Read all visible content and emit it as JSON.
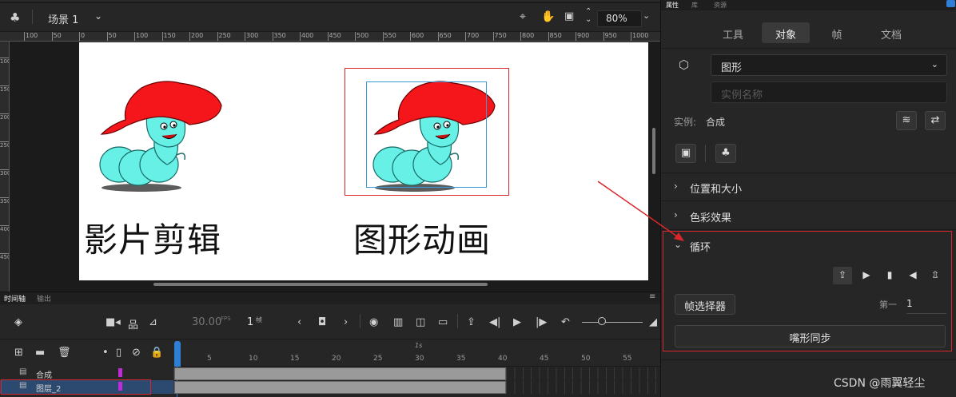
{
  "scene": {
    "label": "场景 1",
    "zoom": "80%"
  },
  "ruler": {
    "top_ticks": [
      "100",
      "50",
      "0",
      "50",
      "100",
      "150",
      "200",
      "250",
      "300",
      "350",
      "400",
      "450",
      "500",
      "550",
      "600",
      "650",
      "700",
      "750",
      "800",
      "850",
      "900",
      "950",
      "1000"
    ],
    "left_ticks": [
      "100",
      "150",
      "200",
      "250",
      "300",
      "350",
      "400",
      "450"
    ]
  },
  "canvas": {
    "caption_left": "影片剪辑",
    "caption_right": "图形动画"
  },
  "timeline": {
    "tab_timeline": "时间轴",
    "tab_output": "输出",
    "fps": "30.00",
    "fps_unit": "FPS",
    "frame": "1",
    "frame_unit": "帧",
    "seconds_marker": "1s",
    "frame_numbers": [
      "5",
      "10",
      "15",
      "20",
      "25",
      "30",
      "35",
      "40",
      "45",
      "50",
      "55"
    ],
    "layers": [
      {
        "name": "合成"
      },
      {
        "name": "图层_2"
      }
    ]
  },
  "panel": {
    "top_tabs": [
      "属性",
      "库",
      "资源"
    ],
    "tabs": [
      "工具",
      "对象",
      "帧",
      "文档"
    ],
    "active_tab": "对象",
    "type_select": "图形",
    "instance_placeholder": "实例名称",
    "instance_label": "实例:",
    "instance_value": "合成",
    "sections": {
      "position_size": "位置和大小",
      "color_effect": "色彩效果",
      "loop": "循环"
    },
    "frame_picker": "帧选择器",
    "first_label": "第一",
    "first_value": "1",
    "lip_sync": "嘴形同步"
  },
  "watermark": "CSDN @雨翼轻尘",
  "colors": {
    "accent_blue": "#2f7fd6",
    "annotation_red": "#d9262b",
    "layer_marker": "#c02bd8"
  }
}
